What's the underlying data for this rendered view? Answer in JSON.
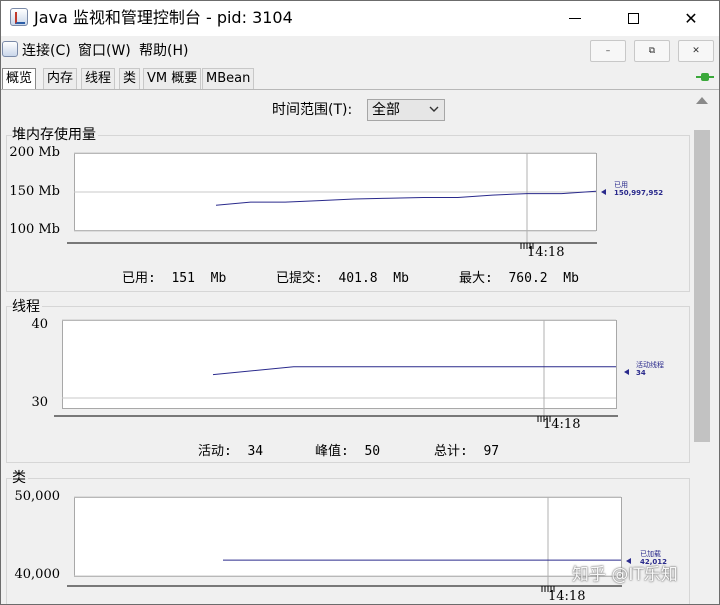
{
  "window": {
    "title": "Java 监视和管理控制台 - pid: 3104",
    "minimize_icon": "minimize-icon",
    "maximize_icon": "maximize-icon",
    "close_glyph": "✕"
  },
  "menu": {
    "items": [
      "连接(C)",
      "窗口(W)",
      "帮助(H)"
    ],
    "frame_buttons": [
      "–",
      "⧉",
      "✕"
    ]
  },
  "tabs": [
    "概览",
    "内存",
    "线程",
    "类",
    "VM 概要",
    "MBean"
  ],
  "active_tab": 0,
  "time_range": {
    "label": "时间范围(T):",
    "value": "全部"
  },
  "colors": {
    "series": "#2a2a8c",
    "plot_bg": "#ffffff",
    "grid": "#c8c8c8",
    "connected": "#3aa83a"
  },
  "panels": {
    "heap": {
      "title": "堆内存使用量",
      "y_ticks": [
        "200 Mb",
        "150 Mb",
        "100 Mb"
      ],
      "x_tick": "14:18",
      "legend_label": "已用",
      "legend_value": "150,997,952",
      "stats": [
        {
          "label": "已用:",
          "value": "151",
          "unit": "Mb"
        },
        {
          "label": "已提交:",
          "value": "401.8",
          "unit": "Mb"
        },
        {
          "label": "最大:",
          "value": "760.2",
          "unit": "Mb"
        }
      ]
    },
    "threads": {
      "title": "线程",
      "y_ticks": [
        "40",
        "30"
      ],
      "x_tick": "14:18",
      "legend_label": "活动线程",
      "legend_value": "34",
      "stats": [
        {
          "label": "活动:",
          "value": "34"
        },
        {
          "label": "峰值:",
          "value": "50"
        },
        {
          "label": "总计:",
          "value": "97"
        }
      ]
    },
    "classes": {
      "title": "类",
      "y_ticks": [
        "50,000",
        "40,000"
      ],
      "x_tick": "14:18",
      "legend_label": "已加载",
      "legend_value": "42,012"
    }
  },
  "chart_data": [
    {
      "type": "line",
      "series": [
        {
          "name": "已用",
          "values": [
            133,
            137,
            137,
            139,
            141,
            142,
            143,
            143,
            146,
            148,
            148,
            151
          ]
        }
      ],
      "ylabel": "Mb",
      "ylim": [
        100,
        200
      ],
      "y_ticks": [
        100,
        150,
        200
      ],
      "x_tick_labels": [
        "14:18"
      ],
      "grid": true,
      "legend": "right"
    },
    {
      "type": "line",
      "series": [
        {
          "name": "活动线程",
          "values": [
            33,
            34,
            34,
            34,
            34,
            34
          ]
        }
      ],
      "ylim": [
        30,
        40
      ],
      "y_ticks": [
        30,
        40
      ],
      "x_tick_labels": [
        "14:18"
      ],
      "grid": true,
      "legend": "right"
    },
    {
      "type": "line",
      "series": [
        {
          "name": "已加载",
          "values": [
            42012,
            42012
          ]
        }
      ],
      "ylim": [
        40000,
        50000
      ],
      "y_ticks": [
        40000,
        50000
      ],
      "x_tick_labels": [
        "14:18"
      ],
      "grid": true,
      "legend": "right"
    }
  ],
  "watermark": "知乎 @IT乐知"
}
